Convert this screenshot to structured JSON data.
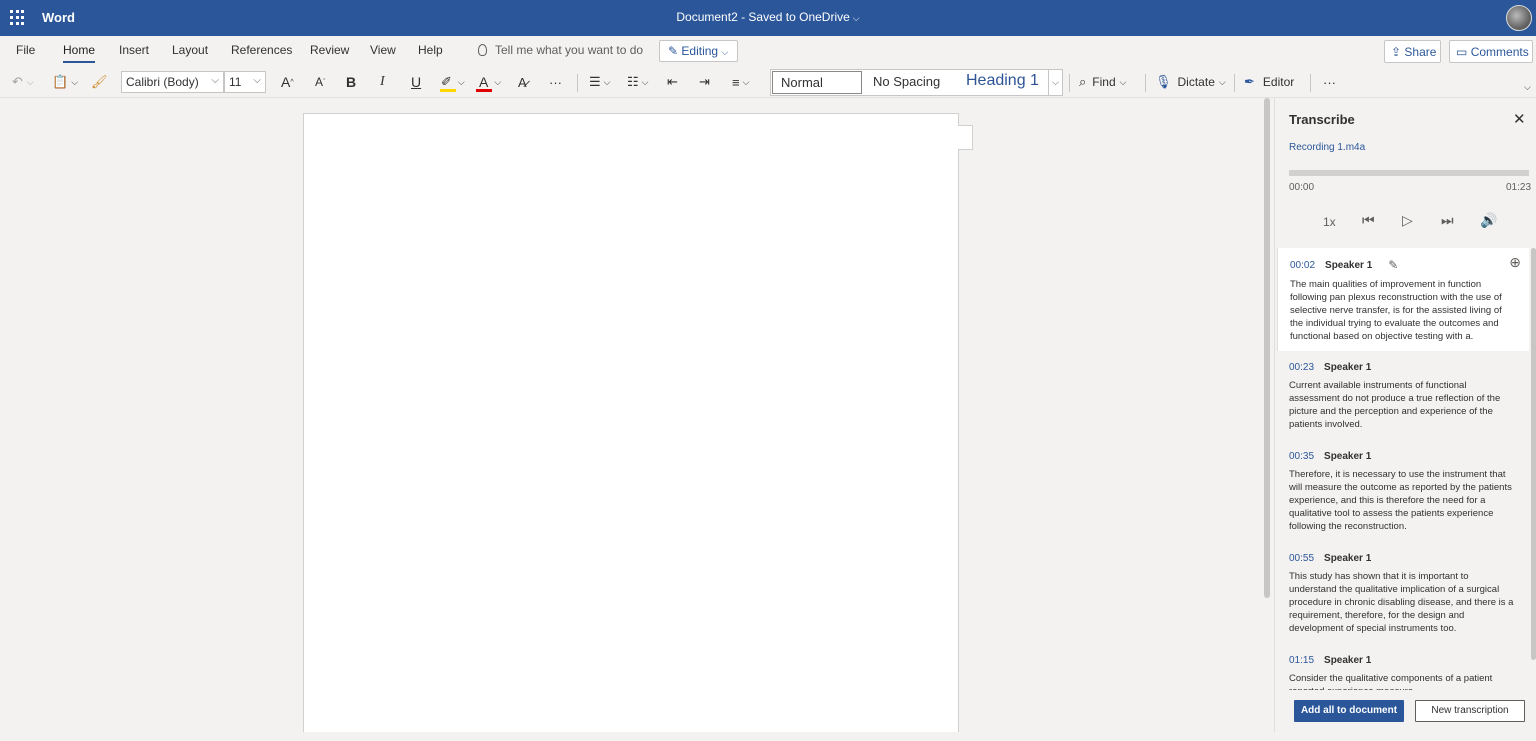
{
  "titlebar": {
    "app_name": "Word",
    "doc_title": "Document2  -  Saved to OneDrive",
    "chevron": "⌵"
  },
  "menu": {
    "items": [
      "File",
      "Home",
      "Insert",
      "Layout",
      "References",
      "Review",
      "View",
      "Help"
    ],
    "active": "Home",
    "tell_me": "Tell me what you want to do",
    "editing": "Editing",
    "share": "Share",
    "comments": "Comments"
  },
  "ribbon": {
    "font_name": "Calibri (Body)",
    "font_size": "11",
    "bold": "B",
    "italic": "I",
    "underline": "U",
    "grow_font": "A",
    "shrink_font": "A",
    "more": "···",
    "styles": {
      "normal": "Normal",
      "no_spacing": "No Spacing",
      "heading1": "Heading 1"
    },
    "find": "Find",
    "dictate": "Dictate",
    "editor": "Editor",
    "highlight_color": "#ffd700",
    "font_color": "#e00000"
  },
  "transcribe": {
    "title": "Transcribe",
    "recording": "Recording 1.m4a",
    "time_start": "00:00",
    "time_end": "01:23",
    "progress": 0,
    "speed": "1x",
    "entries": [
      {
        "time": "00:02",
        "speaker": "Speaker 1",
        "text": "The main qualities of improvement in function following pan plexus reconstruction with the use of selective nerve transfer, is for the assisted living of the individual trying to evaluate the outcomes and functional based on objective testing with a."
      },
      {
        "time": "00:23",
        "speaker": "Speaker 1",
        "text": "Current available instruments of functional assessment do not produce a true reflection of the picture and the perception and experience of the patients involved."
      },
      {
        "time": "00:35",
        "speaker": "Speaker 1",
        "text": "Therefore, it is necessary to use the instrument that will measure the outcome as reported by the patients experience, and this is therefore the need for a qualitative tool to assess the patients experience following the reconstruction."
      },
      {
        "time": "00:55",
        "speaker": "Speaker 1",
        "text": "This study has shown that it is important to understand the qualitative implication of a surgical procedure in chronic disabling disease, and there is a requirement, therefore, for the design and development of special instruments too."
      },
      {
        "time": "01:15",
        "speaker": "Speaker 1",
        "text": "Consider the qualitative components of a patient reported experience measure."
      }
    ],
    "add_all": "Add all to document",
    "new_transcription": "New transcription"
  },
  "colors": {
    "brand": "#2b579a",
    "background": "#f3f2f1"
  }
}
